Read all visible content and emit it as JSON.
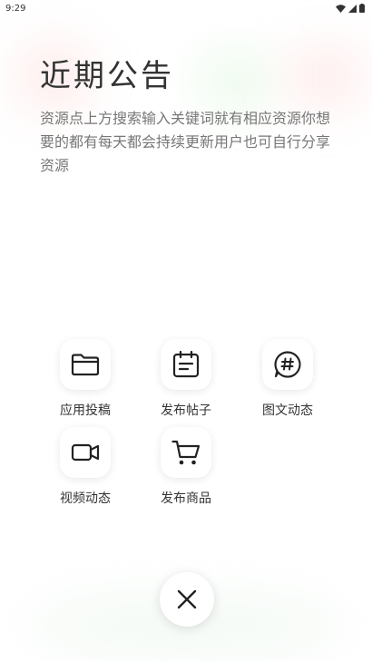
{
  "status_bar": {
    "time": "9:29"
  },
  "notice": {
    "title": "近期公告",
    "body": "资源点上方搜索输入关键词就有相应资源你想要的都有每天都会持续更新用户也可自行分享资源"
  },
  "actions": [
    {
      "label": "应用投稿",
      "icon": "folder-icon"
    },
    {
      "label": "发布帖子",
      "icon": "calendar-note-icon"
    },
    {
      "label": "图文动态",
      "icon": "hashtag-chat-icon"
    },
    {
      "label": "视频动态",
      "icon": "video-camera-icon"
    },
    {
      "label": "发布商品",
      "icon": "shopping-cart-icon"
    }
  ],
  "close": {
    "icon": "close-icon"
  }
}
